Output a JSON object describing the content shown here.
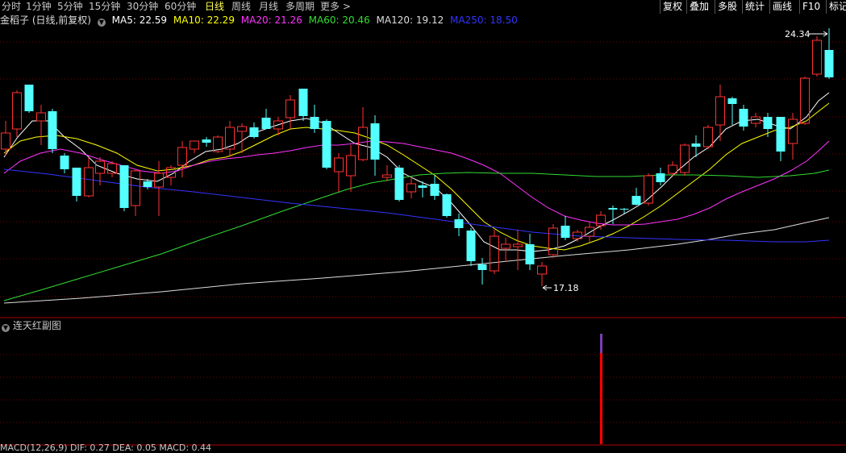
{
  "toolbar": {
    "tabs": [
      "分时",
      "1分钟",
      "5分钟",
      "15分钟",
      "30分钟",
      "60分钟",
      "日线",
      "周线",
      "月线",
      "多周期",
      "更多"
    ],
    "active_tab": "日线",
    "more_arrow": ">",
    "right_buttons": [
      "复权",
      "叠加",
      "多股",
      "统计",
      "画线",
      "F10",
      "标记"
    ]
  },
  "info": {
    "stock_title": "金稻子 (日线,前复权)",
    "collapse_icon": "chevron-down-icon",
    "ma": [
      {
        "label": "MA5: 22.59",
        "color": "#ffffff"
      },
      {
        "label": "MA10: 22.29",
        "color": "#ffff00"
      },
      {
        "label": "MA20: 21.26",
        "color": "#ff33ff"
      },
      {
        "label": "MA60: 20.46",
        "color": "#33dd33"
      },
      {
        "label": "MA120: 19.12",
        "color": "#dddddd"
      },
      {
        "label": "MA250: 18.50",
        "color": "#3333ff"
      }
    ]
  },
  "main_chart": {
    "high_label": "24.34",
    "low_label": "17.18"
  },
  "sub_chart": {
    "title": "连天红副图"
  },
  "bottom": {
    "text": "MACD(12,26,9)  DIF: 0.27  DEA: 0.05  MACD: 0.44"
  },
  "colors": {
    "up": "#ff3232",
    "down": "#54ffff",
    "grid": "#7a0000",
    "frame": "#b00000",
    "ma5": "#ffffff",
    "ma10": "#ffff00",
    "ma20": "#ff33ff",
    "ma60": "#33dd33",
    "ma120": "#dddddd",
    "ma250": "#3333ff"
  }
}
